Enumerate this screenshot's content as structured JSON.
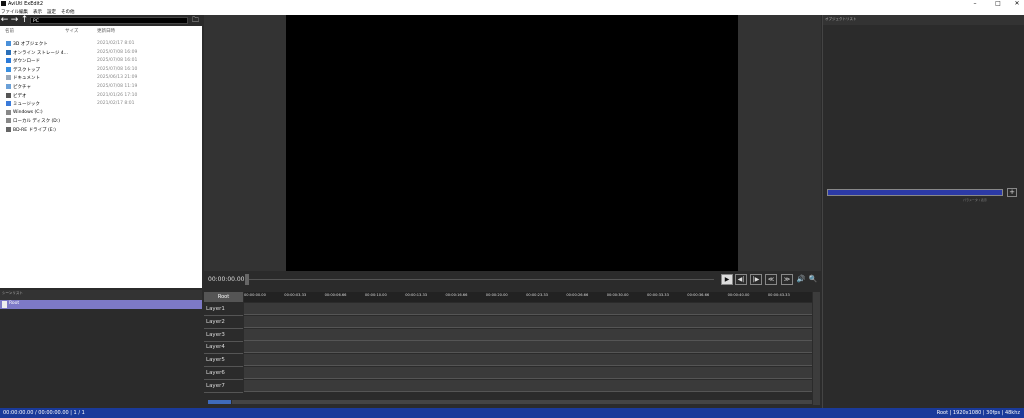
{
  "window": {
    "title": "AviUtl ExEdit2",
    "min_glyph": "–",
    "max_glyph": "□",
    "close_glyph": "✕"
  },
  "menu": [
    "ファイル",
    "編集",
    "表示",
    "設定",
    "その他"
  ],
  "explorer": {
    "back_glyph": "←",
    "forward_glyph": "→",
    "up_glyph": "↑",
    "path": "PC",
    "folder_glyph": "🗀",
    "columns": [
      "名前",
      "サイズ",
      "更新日時"
    ],
    "items": [
      {
        "name": "3D オブジェクト",
        "date": "2021/02/17 8:01",
        "color": "#4a90d9"
      },
      {
        "name": "オンライン ストレージ 4...",
        "date": "2025/07/08 16:09",
        "color": "#2a6fb8"
      },
      {
        "name": "ダウンロード",
        "date": "2025/07/08 16:01",
        "color": "#2a7ad9"
      },
      {
        "name": "デスクトップ",
        "date": "2025/07/08 16:10",
        "color": "#3a8fe0"
      },
      {
        "name": "ドキュメント",
        "date": "2025/06/13 21:09",
        "color": "#9aa8b8"
      },
      {
        "name": "ピクチャ",
        "date": "2025/07/08 11:19",
        "color": "#6aa0d8"
      },
      {
        "name": "ビデオ",
        "date": "2021/01/26 17:10",
        "color": "#555555"
      },
      {
        "name": "ミュージック",
        "date": "2021/02/17 8:01",
        "color": "#3a7ad9"
      },
      {
        "name": "Windows (C:)",
        "date": "",
        "color": "#888888"
      },
      {
        "name": "ローカル ディスク (D:)",
        "date": "",
        "color": "#888888"
      },
      {
        "name": "BD-RE ドライブ (E:)",
        "date": "",
        "color": "#666666"
      }
    ]
  },
  "layer_panel": {
    "header": "シーンリスト",
    "root_label": "Root"
  },
  "object_panel": {
    "header": "オブジェクトリスト"
  },
  "property_panel": {
    "add_glyph": "+",
    "sub_label": "パラメータ / 表示"
  },
  "transport": {
    "timecode": "00:00:00.00",
    "buttons": [
      "▶",
      "◀|",
      "|▶",
      "≪",
      "≫"
    ],
    "volume_glyph": "🔊",
    "zoom_glyph": "🔍"
  },
  "timeline": {
    "root_label": "Root",
    "ticks": [
      "00:00:00.00",
      "00:00:03.33",
      "00:00:06.66",
      "00:00:10.00",
      "00:00:13.33",
      "00:00:16.66",
      "00:00:20.00",
      "00:00:23.33",
      "00:00:26.66",
      "00:00:30.00",
      "00:00:33.33",
      "00:00:36.66",
      "00:00:40.00",
      "00:00:43.33"
    ],
    "layers": [
      "Layer1",
      "Layer2",
      "Layer3",
      "Layer4",
      "Layer5",
      "Layer6",
      "Layer7"
    ]
  },
  "status": {
    "left": "00:00:00.00 / 00:00:00.00  |  1 / 1",
    "right": "Root  |  1920x1080  |  30fps  |  48khz"
  }
}
